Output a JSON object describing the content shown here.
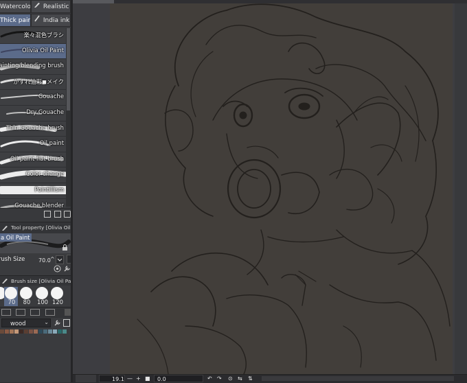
{
  "subtool_tabs": {
    "row1": [
      {
        "label": "Watercolor",
        "icon": "watercolor-brush-icon"
      },
      {
        "label": "Realistic wa",
        "icon": "realistic-watercolor-icon"
      }
    ],
    "row2": [
      {
        "label": "Thick paint",
        "icon": "thick-paint-icon"
      },
      {
        "label": "India ink",
        "icon": "india-ink-icon"
      }
    ]
  },
  "brushes": [
    {
      "label": "楽々混色ブラシ",
      "selected": false
    },
    {
      "label": "Olivia Oil Paint",
      "selected": true
    },
    {
      "label": "painting/blending brush",
      "selected": false
    },
    {
      "label": "かすれ油彩◼メイク",
      "selected": false
    },
    {
      "label": "Gouache",
      "selected": false
    },
    {
      "label": "Dry Gouache",
      "selected": false
    },
    {
      "label": "Thin Gouache brush",
      "selected": false
    },
    {
      "label": "Oil paint",
      "selected": false
    },
    {
      "label": "Oil paint flat brush",
      "selected": false
    },
    {
      "label": "Color change",
      "selected": false
    },
    {
      "label": "Pointillism",
      "selected": false
    },
    {
      "label": "Gouache blender",
      "selected": false
    }
  ],
  "tool_property": {
    "header": "Tool property [Olivia Oil P",
    "preview_name": "a Oil Paint",
    "brush_size_label": "rush Size",
    "brush_size_value": "70.0"
  },
  "brush_size_palette": {
    "header": "Brush size [Olivia Oil Paint]",
    "presets": [
      "70",
      "80",
      "100",
      "120"
    ],
    "selected": "70"
  },
  "texture": {
    "value": "wood"
  },
  "swatch_colors": [
    "#6a4a3a",
    "#8a5a44",
    "#a47658",
    "#c49878",
    "#3e2a24",
    "#5a3e32",
    "#7a5244",
    "#9a6a54",
    "#2e4a5a",
    "#4a6a7a",
    "#6a8a9a",
    "#8aaaba",
    "#2a6a6a",
    "#4a8a8a"
  ],
  "status_bar": {
    "zoom": "19.1",
    "angle": "0.0"
  },
  "colors": {
    "accent": "#5b6b8a",
    "canvas": "#423e3a",
    "linework": "#1e1b19"
  }
}
